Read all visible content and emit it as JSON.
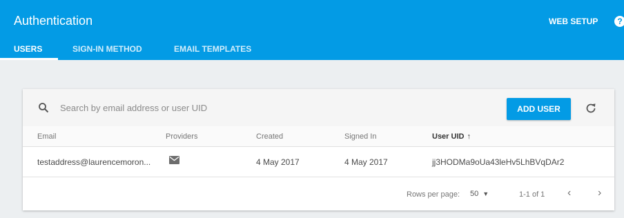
{
  "header": {
    "title": "Authentication",
    "web_setup": "WEB SETUP",
    "help_glyph": "?",
    "accent_color": "#039be5"
  },
  "tabs": [
    {
      "label": "USERS",
      "active": true
    },
    {
      "label": "SIGN-IN METHOD",
      "active": false
    },
    {
      "label": "EMAIL TEMPLATES",
      "active": false
    }
  ],
  "toolbar": {
    "search_placeholder": "Search by email address or user UID",
    "search_value": "",
    "add_user_label": "ADD USER",
    "icons": [
      "search-icon",
      "refresh-icon"
    ]
  },
  "table": {
    "columns": [
      "Email",
      "Providers",
      "Created",
      "Signed In",
      "User UID"
    ],
    "sorted_column": "User UID",
    "sort_glyph": "↑",
    "rows": [
      {
        "email": "testaddress@laurencemoron...",
        "provider_icon": "mail-icon",
        "created": "4 May 2017",
        "signed_in": "4 May 2017",
        "uid": "jj3HODMa9oUa43leHv5LhBVqDAr2"
      }
    ]
  },
  "pagination": {
    "rows_per_page_label": "Rows per page:",
    "rows_per_page_value": "50",
    "range": "1-1 of 1",
    "prev_glyph": "‹",
    "next_glyph": "›"
  }
}
